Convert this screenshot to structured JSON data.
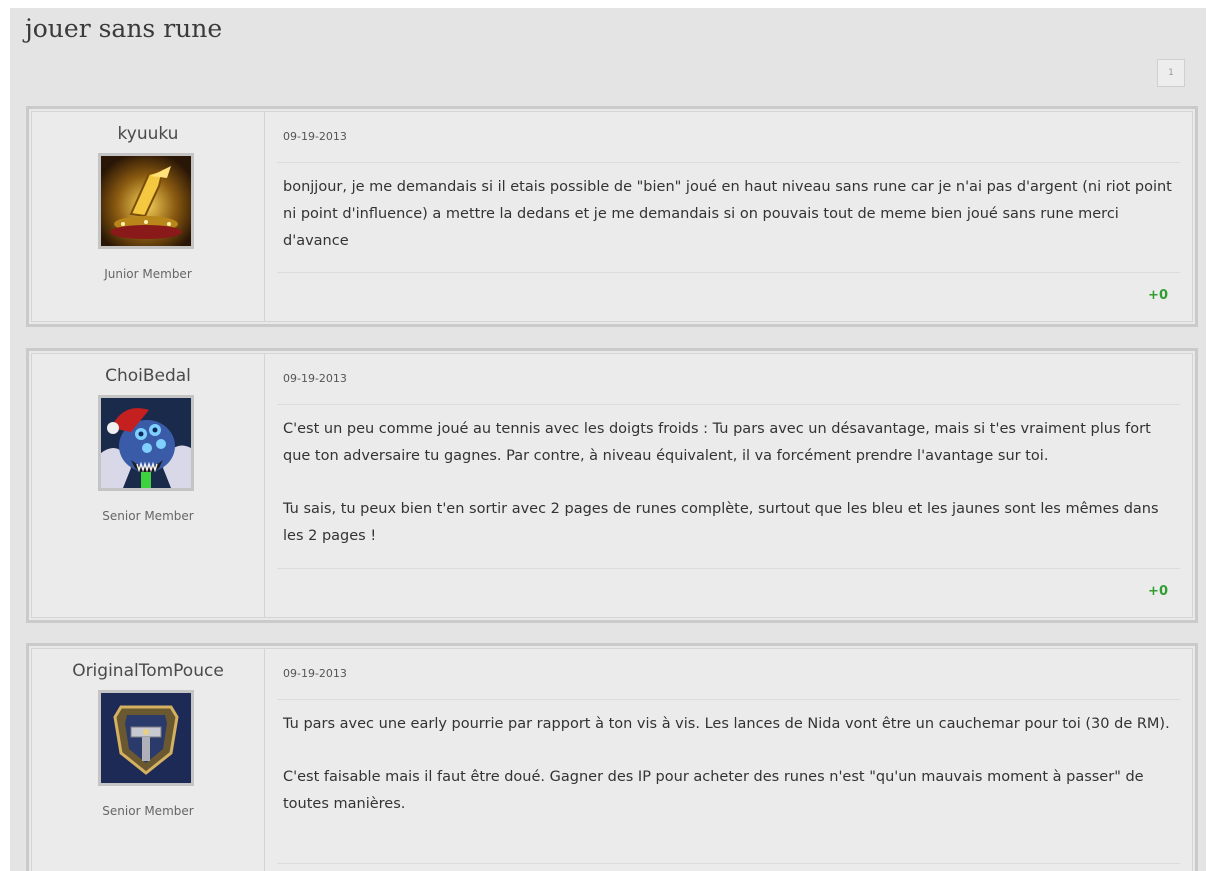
{
  "thread": {
    "title": "jouer sans rune",
    "page_button_label": "1"
  },
  "posts": [
    {
      "author": "kyuuku",
      "rank": "Junior Member",
      "avatar_icon": "golden-gauntlet-avatar",
      "date": "09-19-2013",
      "paragraphs": [
        "bonjjour, je me demandais si il etais possible de \"bien\" joué en haut niveau sans rune car je n'ai pas d'argent (ni riot point ni point d'influence) a mettre la dedans et je me demandais si on pouvais tout de meme bien joué sans rune merci d'avance"
      ],
      "vote": "+0"
    },
    {
      "author": "ChoiBedal",
      "rank": "Senior Member",
      "avatar_icon": "blue-monster-santa-hat-avatar",
      "date": "09-19-2013",
      "paragraphs": [
        "C'est un peu comme joué au tennis avec les doigts froids : Tu pars avec un désavantage, mais si t'es vraiment plus fort que ton adversaire tu gagnes. Par contre, à niveau équivalent, il va forcément prendre l'avantage sur toi.",
        "Tu sais, tu peux bien t'en sortir avec 2 pages de runes complète, surtout que les bleu et les jaunes sont les mêmes dans les 2 pages !"
      ],
      "vote": "+0"
    },
    {
      "author": "OriginalTomPouce",
      "rank": "Senior Member",
      "avatar_icon": "shield-hammer-avatar",
      "date": "09-19-2013",
      "paragraphs": [
        "Tu pars avec une early pourrie par rapport à ton vis à vis. Les lances de Nida vont être un cauchemar pour toi (30 de RM).",
        "C'est faisable mais il faut être doué. Gagner des IP pour acheter des runes n'est \"qu'un mauvais moment à passer\" de toutes manières."
      ],
      "vote": ""
    }
  ],
  "colors": {
    "vote_positive": "#2e9e2e",
    "background": "#e4e4e4",
    "post_border": "#cacaca"
  }
}
